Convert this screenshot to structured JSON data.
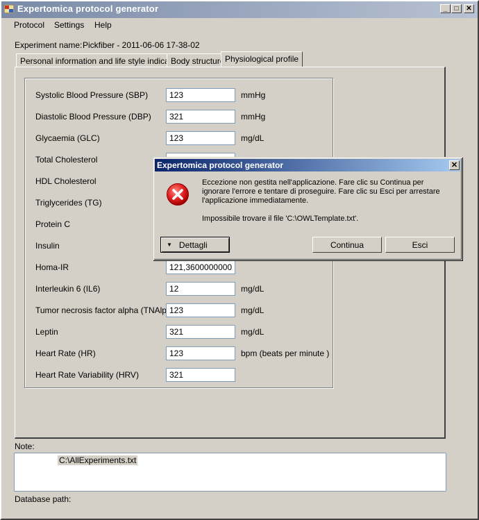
{
  "window": {
    "title": "Expertomica protocol generator",
    "minimize": "_",
    "maximize": "□",
    "close": "✕"
  },
  "menu": {
    "items": [
      "Protocol",
      "Settings",
      "Help"
    ]
  },
  "experiment": {
    "label": "Experiment name:",
    "value": "Pickfiber - 2011-06-06 17-38-02"
  },
  "tabs": [
    {
      "label": "Personal information and life style indicators"
    },
    {
      "label": "Body structure"
    },
    {
      "label": "Physiological profile"
    }
  ],
  "fields": [
    {
      "label": "Systolic Blood Pressure (SBP)",
      "value": "123",
      "unit": "mmHg"
    },
    {
      "label": "Diastolic Blood Pressure (DBP)",
      "value": "321",
      "unit": "mmHg"
    },
    {
      "label": "Glycaemia (GLC)",
      "value": "123",
      "unit": "mg/dL"
    },
    {
      "label": "Total Cholesterol",
      "value": "",
      "unit": ""
    },
    {
      "label": "HDL Cholesterol",
      "value": "",
      "unit": ""
    },
    {
      "label": "Triglycerides (TG)",
      "value": "",
      "unit": ""
    },
    {
      "label": "Protein C",
      "value": "",
      "unit": ""
    },
    {
      "label": "Insulin",
      "value": "",
      "unit": ""
    },
    {
      "label": "Homa-IR",
      "value": "121,3600000000",
      "unit": ""
    },
    {
      "label": "Interleukin 6 (IL6)",
      "value": "12",
      "unit": "mg/dL"
    },
    {
      "label": "Tumor necrosis factor alpha (TNAlpha)",
      "value": "123",
      "unit": "mg/dL"
    },
    {
      "label": "Leptin",
      "value": "321",
      "unit": "mg/dL"
    },
    {
      "label": "Heart Rate (HR)",
      "value": "123",
      "unit": "bpm (beats per minute )"
    },
    {
      "label": "Heart Rate Variability (HRV)",
      "value": "321",
      "unit": ""
    }
  ],
  "note": {
    "label": "Note:",
    "value": "C:\\AllExperiments.txt"
  },
  "database": {
    "label": "Database path:"
  },
  "dialog": {
    "title": "Expertomica protocol generator",
    "close": "✕",
    "message": "Eccezione non gestita nell'applicazione. Fare clic su Continua per ignorare l'errore e tentare di proseguire. Fare clic su Esci per arrestare l'applicazione immediatamente.",
    "detail": "Impossibile trovare il file 'C:\\OWLTemplate.txt'.",
    "details_button": "Dettagli",
    "continue_button": "Continua",
    "exit_button": "Esci"
  },
  "colors": {
    "window_bg": "#d4d0c8",
    "dialog_title_start": "#0a246a",
    "dialog_title_end": "#a6caf0",
    "error_red": "#e02020"
  }
}
